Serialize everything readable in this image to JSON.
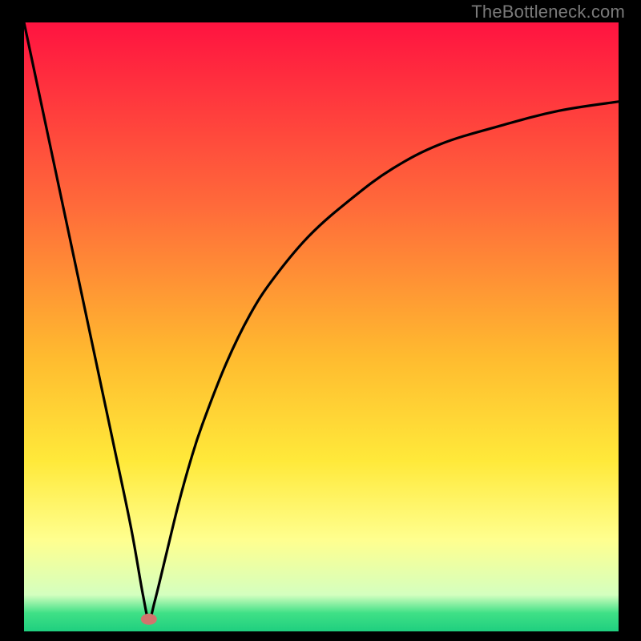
{
  "watermark": "TheBottleneck.com",
  "colors": {
    "bg": "#000000",
    "gradient_top": "#ff1340",
    "gradient_mid1": "#ff6a3a",
    "gradient_mid2": "#ffbb2f",
    "gradient_yellow": "#ffe93a",
    "gradient_lightyellow": "#ffff8f",
    "gradient_green": "#2fdf7b",
    "gradient_green_bottom": "#1fcf7f",
    "curve": "#000000",
    "marker": "#d1746d"
  },
  "chart_data": {
    "type": "line",
    "title": "",
    "xlabel": "",
    "ylabel": "",
    "xlim": [
      0,
      100
    ],
    "ylim": [
      0,
      100
    ],
    "grid": false,
    "note": "Bottleneck-style curve: steep linear descent from top-left to a minimum near x≈21, then an asymptotic rise toward the right. Values are in percentage of plot height (0=bottom, 100=top).",
    "series": [
      {
        "name": "bottleneck-curve",
        "x": [
          0,
          5,
          10,
          15,
          18,
          20,
          21,
          22,
          24,
          26,
          28,
          30,
          34,
          38,
          42,
          48,
          55,
          62,
          70,
          80,
          90,
          100
        ],
        "y": [
          100,
          77,
          54,
          31,
          17,
          6,
          2,
          5,
          13,
          21,
          28,
          34,
          44,
          52,
          58,
          65,
          71,
          76,
          80,
          83,
          85.5,
          87
        ]
      }
    ],
    "marker": {
      "x": 21,
      "y": 2,
      "shape": "ellipse",
      "color": "#d1746d"
    },
    "gradient_stops_pct": [
      {
        "offset": 0,
        "color": "#ff1340"
      },
      {
        "offset": 30,
        "color": "#ff6a3a"
      },
      {
        "offset": 55,
        "color": "#ffbb2f"
      },
      {
        "offset": 72,
        "color": "#ffe93a"
      },
      {
        "offset": 85,
        "color": "#ffff8f"
      },
      {
        "offset": 94,
        "color": "#d4ffbf"
      },
      {
        "offset": 97,
        "color": "#3fe086"
      },
      {
        "offset": 100,
        "color": "#1fcf7f"
      }
    ]
  }
}
